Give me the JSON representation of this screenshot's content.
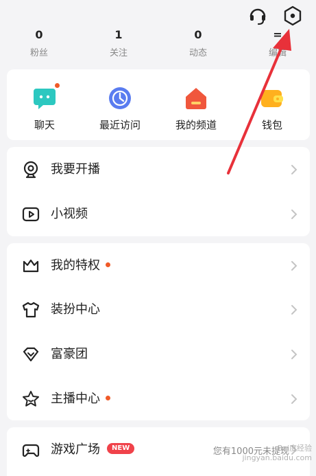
{
  "stats": [
    {
      "value": "0",
      "label": "粉丝"
    },
    {
      "value": "1",
      "label": "关注"
    },
    {
      "value": "0",
      "label": "动态"
    },
    {
      "value": "=",
      "label": "编辑"
    }
  ],
  "header": {
    "support_icon": "headset-icon",
    "settings_icon": "hexagon-settings-icon"
  },
  "quick_access": [
    {
      "label": "聊天",
      "icon": "chat-bubble-icon",
      "color": "#2cc8c0",
      "has_dot": true
    },
    {
      "label": "最近访问",
      "icon": "clock-icon",
      "color": "#5a7cf0",
      "has_dot": false
    },
    {
      "label": "我的频道",
      "icon": "home-channel-icon",
      "color": "#f0573c",
      "has_dot": false
    },
    {
      "label": "钱包",
      "icon": "wallet-icon",
      "color": "#ffb01e",
      "has_dot": false
    }
  ],
  "group1": [
    {
      "label": "我要开播",
      "icon": "webcam-icon"
    },
    {
      "label": "小视频",
      "icon": "video-play-icon"
    }
  ],
  "group2": [
    {
      "label": "我的特权",
      "icon": "crown-icon",
      "has_dot": true
    },
    {
      "label": "装扮中心",
      "icon": "tshirt-icon",
      "has_dot": false
    },
    {
      "label": "富豪团",
      "icon": "diamond-icon",
      "has_dot": false
    },
    {
      "label": "主播中心",
      "icon": "star-icon",
      "has_dot": true
    }
  ],
  "group3": [
    {
      "label": "游戏广场",
      "icon": "gamepad-icon",
      "badge": "NEW",
      "subtext": "您有1000元未提现"
    }
  ],
  "watermark": {
    "line1": "Bai度经验",
    "line2": "jingyan.baidu.com"
  },
  "colors": {
    "accent": "#f05a28",
    "arrow": "#e8313a",
    "badge": "#f0424a"
  }
}
